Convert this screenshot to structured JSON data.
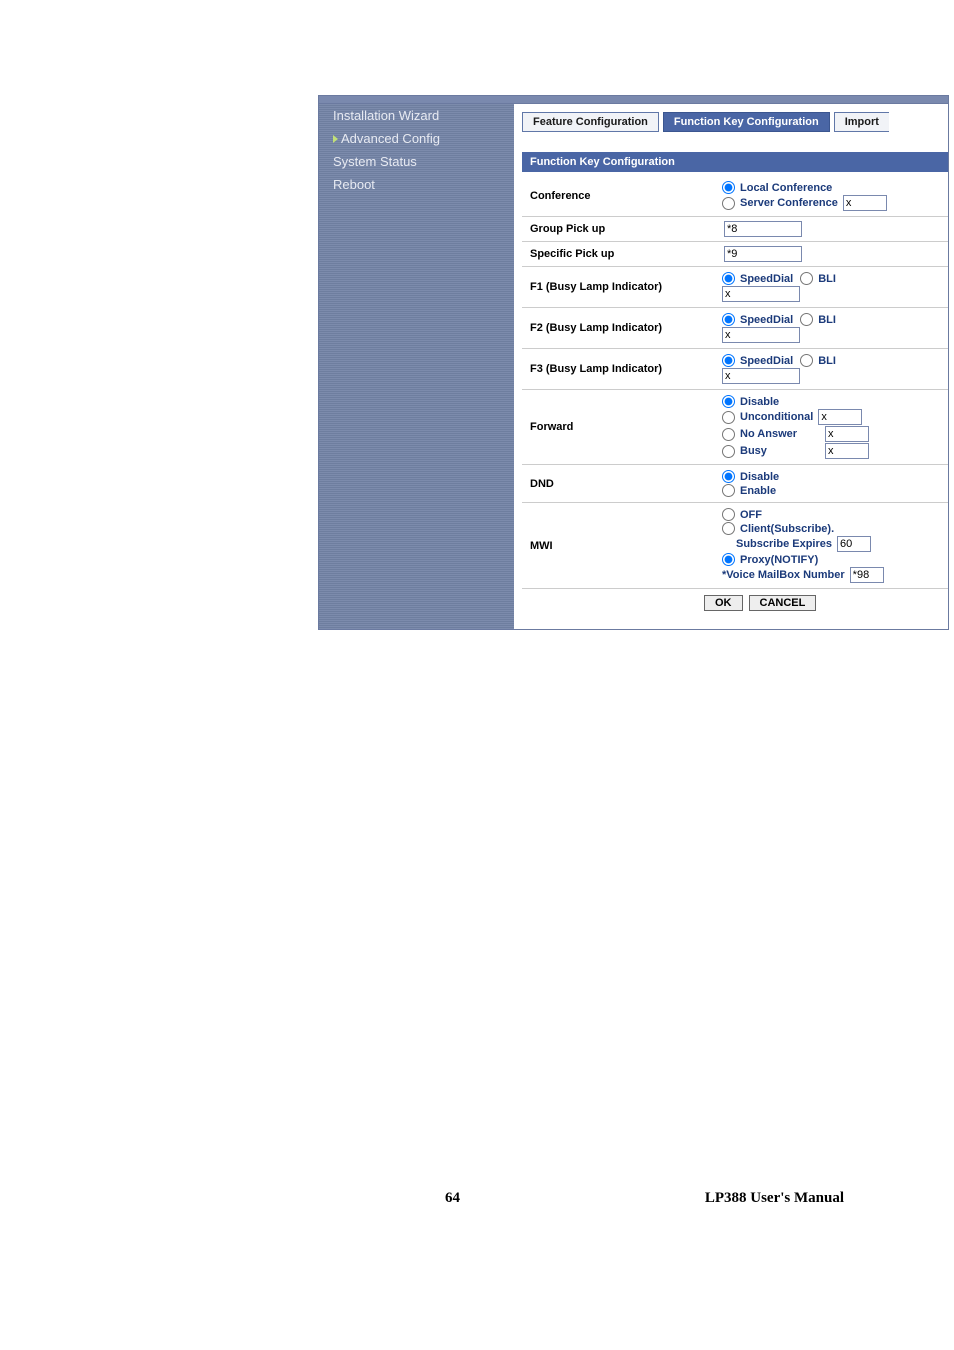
{
  "sidebar": {
    "items": [
      {
        "label": "Installation Wizard"
      },
      {
        "label": "Advanced Config"
      },
      {
        "label": "System Status"
      },
      {
        "label": "Reboot"
      }
    ]
  },
  "tabs": {
    "feature": "Feature Configuration",
    "funckey": "Function Key Configuration",
    "import": "Import"
  },
  "section_title": "Function Key Configuration",
  "rows": {
    "conference": {
      "label": "Conference",
      "local": "Local Conference",
      "server": "Server Conference",
      "server_val": "x"
    },
    "group_pickup": {
      "label": "Group Pick up",
      "val": "*8"
    },
    "specific_pickup": {
      "label": "Specific Pick up",
      "val": "*9"
    },
    "f1": {
      "label": "F1 (Busy Lamp Indicator)",
      "speed": "SpeedDial",
      "bli": "BLI",
      "val": "x"
    },
    "f2": {
      "label": "F2 (Busy Lamp Indicator)",
      "speed": "SpeedDial",
      "bli": "BLI",
      "val": "x"
    },
    "f3": {
      "label": "F3 (Busy Lamp Indicator)",
      "speed": "SpeedDial",
      "bli": "BLI",
      "val": "x"
    },
    "forward": {
      "label": "Forward",
      "disable": "Disable",
      "uncond": "Unconditional",
      "uncond_val": "x",
      "noans": "No Answer",
      "noans_val": "x",
      "busy": "Busy",
      "busy_val": "x"
    },
    "dnd": {
      "label": "DND",
      "disable": "Disable",
      "enable": "Enable"
    },
    "mwi": {
      "label": "MWI",
      "off": "OFF",
      "client": "Client(Subscribe).",
      "sub_exp": "Subscribe Expires",
      "sub_exp_val": "60",
      "proxy": "Proxy(NOTIFY)",
      "vmbox": "*Voice MailBox Number",
      "vmbox_val": "*98"
    }
  },
  "buttons": {
    "ok": "OK",
    "cancel": "CANCEL"
  },
  "footer": {
    "page": "64",
    "manual": "LP388  User's  Manual"
  }
}
